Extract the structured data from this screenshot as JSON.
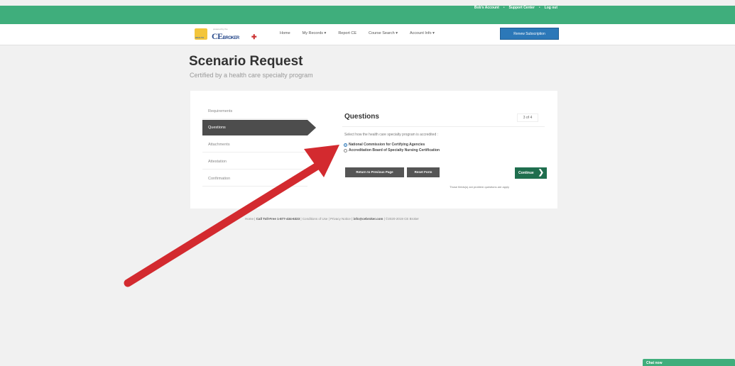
{
  "top_links": [
    "Bob's Account",
    "Support Center",
    "Log out"
  ],
  "logo": {
    "powered": "powered by the",
    "brand": "CE",
    "brand_suffix": "BROKER",
    "badge_text": "HEALTH"
  },
  "nav": {
    "items": [
      "Home",
      "My Records ▾",
      "Report CE",
      "Course Search ▾",
      "Account Info ▾"
    ],
    "renew_label": "Renew Subscription"
  },
  "page": {
    "title": "Scenario Request",
    "subtitle": "Certified by a health care specialty program"
  },
  "steps": [
    "Requirements",
    "Questions",
    "Attachments",
    "Attestation",
    "Confirmation"
  ],
  "question": {
    "title": "Questions",
    "progress": "3 of 4",
    "prompt": "Select how the health care specialty program is accredited :",
    "options": [
      {
        "label": "National Commission for Certifying Agencies",
        "checked": true
      },
      {
        "label": "Accreditation Board of Specialty Nursing Certification",
        "checked": false
      }
    ]
  },
  "buttons": {
    "previous": "Return to Previous Page",
    "reset": "Reset Form",
    "continue": "Continue"
  },
  "required_note": "Those fields(s) ani problem questions are apply",
  "footer": {
    "home": "Home",
    "phone": "Call Toll-Free 1-877-434-6323",
    "terms": "Conditions of Use",
    "privacy": "Privacy Notice",
    "email": "info@cebroker.com",
    "copyright": "©2020-2019 CE Broker"
  },
  "chat": {
    "label": "Chat now"
  },
  "colors": {
    "green": "#3fae7c",
    "blue": "#2c78b8",
    "arrow": "#d32a2f"
  }
}
